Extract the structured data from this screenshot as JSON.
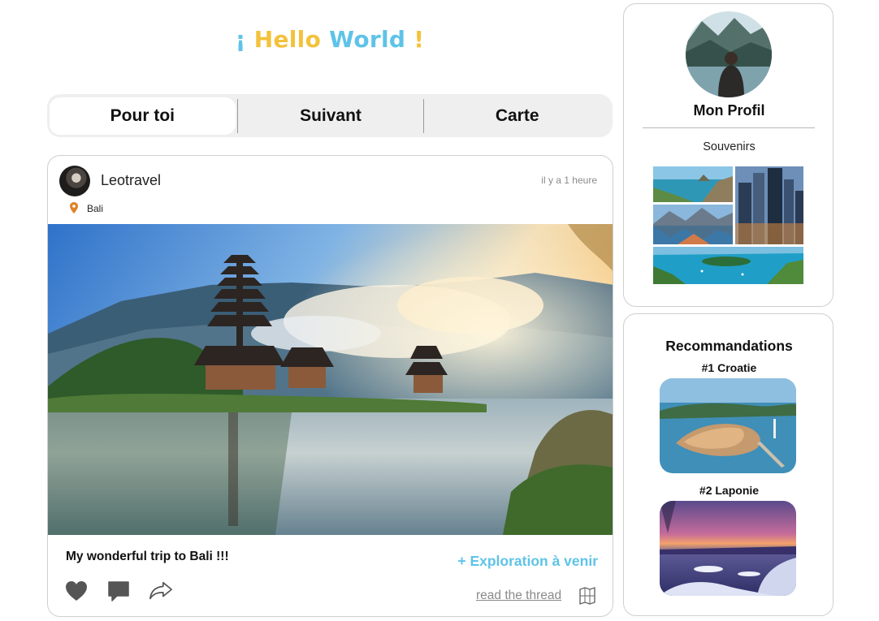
{
  "header": {
    "title_open": "¡ ",
    "title_word1": "Hello",
    "title_word2": "World",
    "title_close": " !"
  },
  "tabs": [
    {
      "label": "Pour toi",
      "active": true
    },
    {
      "label": "Suivant",
      "active": false
    },
    {
      "label": "Carte",
      "active": false
    }
  ],
  "post": {
    "author": "Leotravel",
    "time": "il y a 1 heure",
    "location": "Bali",
    "caption": "My wonderful trip to Bali !!!",
    "explore_label": "+ Exploration à venir",
    "thread_label": "read the thread",
    "icons": [
      "heart-icon",
      "comment-icon",
      "share-icon",
      "map-icon",
      "location-pin-icon"
    ]
  },
  "profile": {
    "title": "Mon Profil",
    "souvenirs_label": "Souvenirs"
  },
  "recommendations": {
    "title": "Recommandations",
    "items": [
      {
        "label": "#1 Croatie"
      },
      {
        "label": "#2 Laponie"
      }
    ]
  },
  "colors": {
    "accent_yellow": "#f3c23c",
    "accent_blue": "#5ec3e8",
    "tab_background": "#efefef",
    "icon_gray": "#555555",
    "border": "#cfcfcf"
  }
}
